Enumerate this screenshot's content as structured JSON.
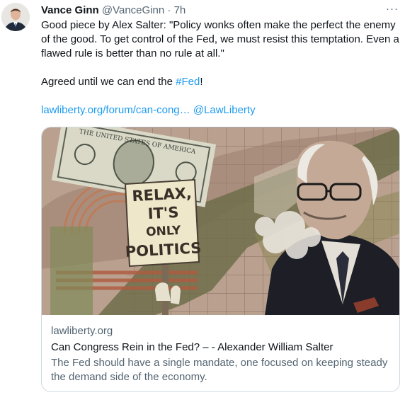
{
  "author": {
    "name": "Vance Ginn",
    "handle": "@VanceGinn",
    "separator": "·",
    "time": "7h"
  },
  "more_icon": "ellipsis-icon",
  "tweet": {
    "line1": "Good piece by Alex Salter: \"Policy wonks often make the perfect the enemy of the good. To get control of the Fed, we must resist this temptation. Even a flawed rule is better than no rule at all.\"",
    "line2_prefix": "Agreed until we can end the ",
    "hashtag": "#Fed",
    "line2_suffix": "!",
    "link": "lawliberty.org/forum/can-cong…",
    "mention": "@LawLiberty"
  },
  "card": {
    "domain": "lawliberty.org",
    "title": "Can Congress Rein in the Fed? – - Alexander William Salter",
    "description": "The Fed should have a single mandate, one focused on keeping steady the demand side of the economy.",
    "image": {
      "sign_line1": "RELAX,",
      "sign_line2": "IT'S",
      "sign_line3": "ONLY",
      "sign_line4": "POLITICS",
      "bill_text": "THE UNITED STATES OF AMERICA"
    }
  },
  "colors": {
    "link": "#1d9bf0",
    "secondary_text": "#536471",
    "card_border": "#cfd9de",
    "image_background": "#b9a08f"
  }
}
